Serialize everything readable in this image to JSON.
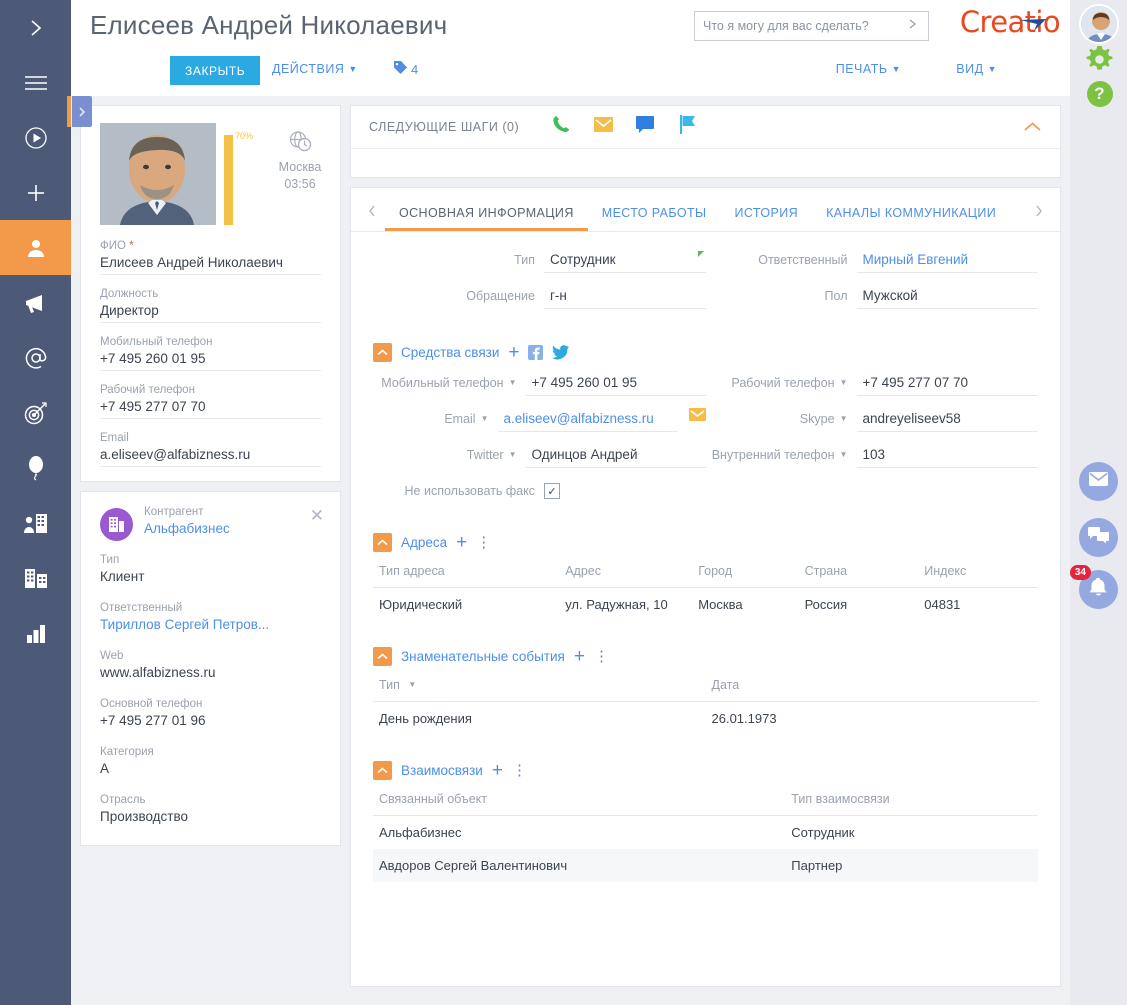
{
  "header": {
    "title": "Елисеев Андрей Николаевич",
    "search_placeholder": "Что я могу для вас сделать?",
    "logo": "Creatio",
    "close_button": "ЗАКРЫТЬ",
    "actions_button": "ДЕЙСТВИЯ",
    "tags_count": "4",
    "print_button": "ПЕЧАТЬ",
    "view_button": "ВИД"
  },
  "rail": {
    "items": [
      {
        "name": "expand-icon"
      },
      {
        "name": "menu-icon"
      },
      {
        "name": "play-icon"
      },
      {
        "name": "plus-icon"
      },
      {
        "name": "contact-icon"
      },
      {
        "name": "megaphone-icon"
      },
      {
        "name": "at-icon"
      },
      {
        "name": "target-icon"
      },
      {
        "name": "balloon-icon"
      },
      {
        "name": "employees-icon"
      },
      {
        "name": "building-icon"
      },
      {
        "name": "chart-icon"
      }
    ]
  },
  "right_rail": {
    "notifications_badge": "34"
  },
  "left_panel": {
    "progress_percent": "70%",
    "timezone_city": "Москва",
    "timezone_time": "03:56",
    "fields": [
      {
        "label": "ФИО",
        "value": "Елисеев Андрей Николаевич",
        "required": true
      },
      {
        "label": "Должность",
        "value": "Директор",
        "required": false
      },
      {
        "label": "Мобильный телефон",
        "value": "+7 495 260 01 95",
        "required": false
      },
      {
        "label": "Рабочий телефон",
        "value": "+7 495 277 07 70",
        "required": false
      },
      {
        "label": "Email",
        "value": "a.eliseev@alfabizness.ru",
        "required": false
      }
    ],
    "account": {
      "label": "Контрагент",
      "name": "Альфабизнес",
      "fields": [
        {
          "label": "Тип",
          "value": "Клиент",
          "link": false
        },
        {
          "label": "Ответственный",
          "value": "Тириллов Сергей Петров...",
          "link": true
        },
        {
          "label": "Web",
          "value": "www.alfabizness.ru",
          "link": false
        },
        {
          "label": "Основной телефон",
          "value": "+7 495 277 01 96",
          "link": false
        },
        {
          "label": "Категория",
          "value": "А",
          "link": false
        },
        {
          "label": "Отрасль",
          "value": "Производство",
          "link": false
        }
      ]
    }
  },
  "main": {
    "next_steps_title": "СЛЕДУЮЩИЕ ШАГИ (0)",
    "tabs": [
      {
        "label": "ОСНОВНАЯ ИНФОРМАЦИЯ",
        "active": true
      },
      {
        "label": "МЕСТО РАБОТЫ",
        "active": false
      },
      {
        "label": "ИСТОРИЯ",
        "active": false
      },
      {
        "label": "КАНАЛЫ  КОММУНИКАЦИИ",
        "active": false
      }
    ],
    "top_form": {
      "left": [
        {
          "label": "Тип",
          "value": "Сотрудник",
          "link": false
        },
        {
          "label": "Обращение",
          "value": "г-н",
          "link": false
        }
      ],
      "right": [
        {
          "label": "Ответственный",
          "value": "Мирный Евгений",
          "link": true,
          "required": true
        },
        {
          "label": "Пол",
          "value": "Мужской",
          "link": false,
          "required": false
        }
      ]
    },
    "communication": {
      "title": "Средства связи",
      "left": [
        {
          "label": "Мобильный телефон",
          "value": "+7 495 260 01 95",
          "link": false,
          "dropdown": true
        },
        {
          "label": "Email",
          "value": "a.eliseev@alfabizness.ru",
          "link": true,
          "dropdown": true
        },
        {
          "label": "Twitter",
          "value": "Одинцов Андрей",
          "link": false,
          "dropdown": true
        }
      ],
      "right": [
        {
          "label": "Рабочий телефон",
          "value": "+7 495 277 07 70",
          "link": false,
          "dropdown": true
        },
        {
          "label": "Skype",
          "value": "andreyeliseev58",
          "link": false,
          "dropdown": true
        },
        {
          "label": "Внутренний телефон",
          "value": "103",
          "link": false,
          "dropdown": true
        }
      ],
      "no_fax_label": "Не использовать факс",
      "no_fax_checked": "✓"
    },
    "addresses": {
      "title": "Адреса",
      "columns": [
        "Тип адреса",
        "Адрес",
        "Город",
        "Страна",
        "Индекс"
      ],
      "rows": [
        [
          "Юридический",
          "ул. Радужная, 10",
          "Москва",
          "Россия",
          "04831"
        ]
      ]
    },
    "events": {
      "title": "Знаменательные события",
      "columns": [
        "Тип",
        "Дата"
      ],
      "rows": [
        [
          "День рождения",
          "26.01.1973"
        ]
      ]
    },
    "relations": {
      "title": "Взаимосвязи",
      "columns": [
        "Связанный объект",
        "Тип взаимосвязи"
      ],
      "rows": [
        [
          "Альфабизнес",
          "Сотрудник"
        ],
        [
          "Авдоров Сергей Валентинович",
          "Партнер"
        ]
      ]
    }
  },
  "colors": {
    "accent_orange": "#f2994a",
    "link_blue": "#4d8fe8",
    "rail_bg": "#4c5a78",
    "button_blue": "#2baae2",
    "logo_red": "#e8491f",
    "badge_red": "#e8243c"
  }
}
